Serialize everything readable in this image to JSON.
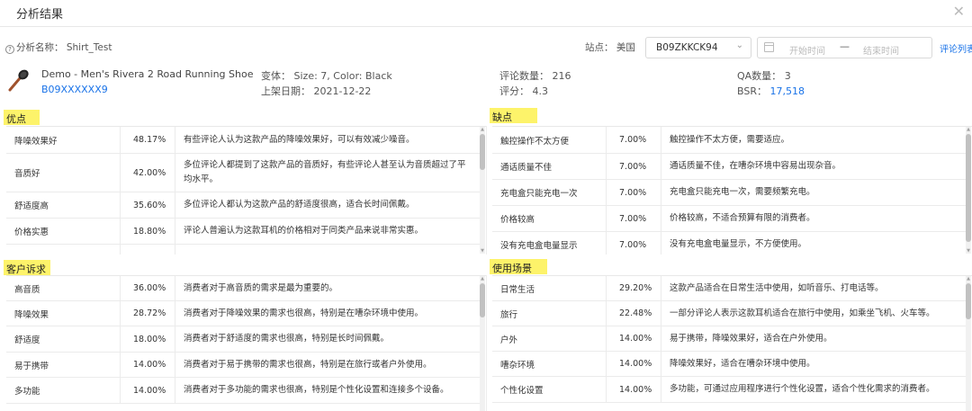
{
  "dialog": {
    "title": "分析结果",
    "close_glyph": "✕"
  },
  "filter": {
    "name_label": "分析名称：",
    "name_value": "Shirt_Test",
    "site_label": "站点：",
    "site_value": "美国",
    "asin_selected": "B09ZKKCK94",
    "date_start_placeholder": "开始时间",
    "date_sep": "—",
    "date_end_placeholder": "结束时间",
    "review_list_link": "评论列表"
  },
  "product": {
    "name": "Demo - Men's Rivera 2 Road Running Shoe",
    "asin": "B09XXXXXX9",
    "variant_label": "变体：",
    "variant_value": "Size: 7, Color: Black",
    "listed_label": "上架日期：",
    "listed_value": "2021-12-22",
    "review_count_label": "评论数量：",
    "review_count_value": "216",
    "rating_label": "评分：",
    "rating_value": "4.3",
    "qa_label": "QA数量：",
    "qa_value": "3",
    "bsr_label": "BSR：",
    "bsr_value": "17,518",
    "icon": "hairbrush-product-thumbnail"
  },
  "sections": {
    "pros": {
      "title": "优点",
      "rows": [
        {
          "name": "降噪效果好",
          "pct": "48.17%",
          "desc": "有些评论人认为这款产品的降噪效果好，可以有效减少噪音。"
        },
        {
          "name": "音质好",
          "pct": "42.00%",
          "desc": "多位评论人都提到了这款产品的音质好，有些评论人甚至认为音质超过了平均水平。"
        },
        {
          "name": "舒适度高",
          "pct": "35.60%",
          "desc": "多位评论人都认为这款产品的舒适度很高，适合长时间佩戴。"
        },
        {
          "name": "价格实惠",
          "pct": "18.80%",
          "desc": "评论人普遍认为这款耳机的价格相对于同类产品来说非常实惠。"
        }
      ]
    },
    "cons": {
      "title": "缺点",
      "rows": [
        {
          "name": "触控操作不太方便",
          "pct": "7.00%",
          "desc": "触控操作不太方便，需要适应。"
        },
        {
          "name": "通话质量不佳",
          "pct": "7.00%",
          "desc": "通话质量不佳，在嘈杂环境中容易出现杂音。"
        },
        {
          "name": "充电盒只能充电一次",
          "pct": "7.00%",
          "desc": "充电盒只能充电一次，需要频繁充电。"
        },
        {
          "name": "价格较高",
          "pct": "7.00%",
          "desc": "价格较高，不适合预算有限的消费者。"
        },
        {
          "name": "没有充电盒电量显示",
          "pct": "7.00%",
          "desc": "没有充电盒电量显示，不方便使用。"
        }
      ]
    },
    "needs": {
      "title": "客户诉求",
      "rows": [
        {
          "name": "高音质",
          "pct": "36.00%",
          "desc": "消费者对于高音质的需求是最为重要的。"
        },
        {
          "name": "降噪效果",
          "pct": "28.72%",
          "desc": "消费者对于降噪效果的需求也很高，特别是在嘈杂环境中使用。"
        },
        {
          "name": "舒适度",
          "pct": "18.00%",
          "desc": "消费者对于舒适度的需求也很高，特别是长时间佩戴。"
        },
        {
          "name": "易于携带",
          "pct": "14.00%",
          "desc": "消费者对于易于携带的需求也很高，特别是在旅行或者户外使用。"
        },
        {
          "name": "多功能",
          "pct": "14.00%",
          "desc": "消费者对于多功能的需求也很高，特别是个性化设置和连接多个设备。"
        }
      ]
    },
    "scenarios": {
      "title": "使用场景",
      "rows": [
        {
          "name": "日常生活",
          "pct": "29.20%",
          "desc": "这款产品适合在日常生活中使用，如听音乐、打电话等。"
        },
        {
          "name": "旅行",
          "pct": "22.48%",
          "desc": "一部分评论人表示这款耳机适合在旅行中使用，如乘坐飞机、火车等。"
        },
        {
          "name": "户外",
          "pct": "14.00%",
          "desc": "易于携带，降噪效果好，适合在户外使用。"
        },
        {
          "name": "嘈杂环境",
          "pct": "14.00%",
          "desc": "降噪效果好，适合在嘈杂环境中使用。"
        },
        {
          "name": "个性化设置",
          "pct": "14.00%",
          "desc": "多功能，可通过应用程序进行个性化设置，适合个性化需求的消费者。"
        }
      ]
    }
  },
  "colors": {
    "highlight": "#fdf36a",
    "link": "#1a73e8"
  }
}
